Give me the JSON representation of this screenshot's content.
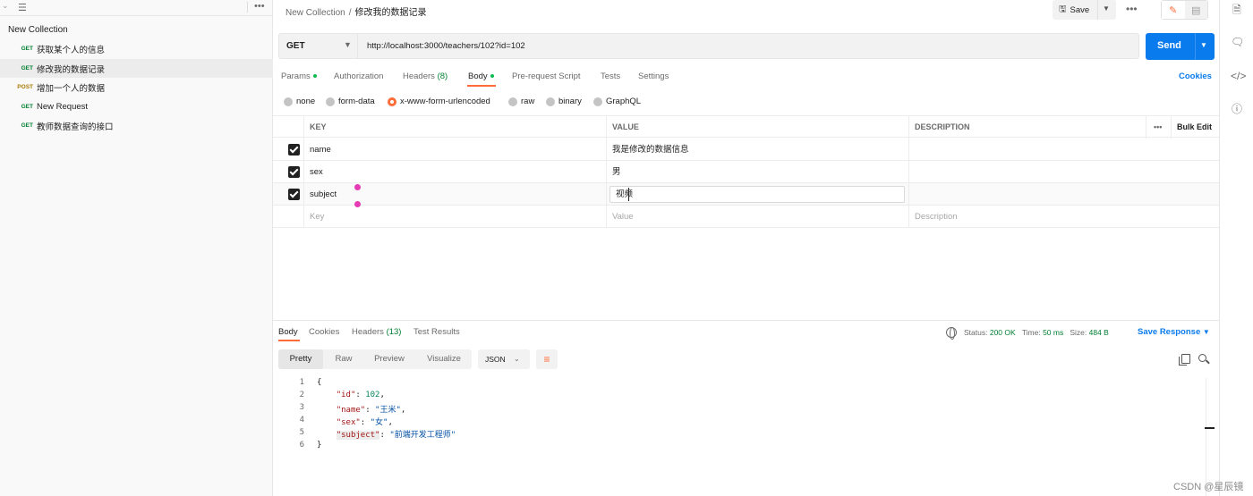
{
  "sidebar": {
    "collection_title": "New Collection",
    "requests": [
      {
        "method": "GET",
        "name": "获取某个人的信息"
      },
      {
        "method": "GET",
        "name": "修改我的数据记录"
      },
      {
        "method": "POST",
        "name": "增加一个人的数据"
      },
      {
        "method": "GET",
        "name": "New Request"
      },
      {
        "method": "GET",
        "name": "教师数据查询的接口"
      }
    ]
  },
  "header": {
    "breadcrumb_collection": "New Collection",
    "breadcrumb_separator": "/",
    "breadcrumb_request": "修改我的数据记录",
    "save_label": "Save"
  },
  "request": {
    "method": "GET",
    "url": "http://localhost:3000/teachers/102?id=102",
    "send_label": "Send",
    "tabs": {
      "params": "Params",
      "authorization": "Authorization",
      "headers": "Headers",
      "headers_count": "(8)",
      "body": "Body",
      "pre_request": "Pre-request Script",
      "tests": "Tests",
      "settings": "Settings"
    },
    "cookies_label": "Cookies",
    "body_types": [
      "none",
      "form-data",
      "x-www-form-urlencoded",
      "raw",
      "binary",
      "GraphQL"
    ],
    "table": {
      "headers": {
        "key": "KEY",
        "value": "VALUE",
        "description": "DESCRIPTION",
        "more": "•••",
        "bulk_edit": "Bulk Edit"
      },
      "rows": [
        {
          "key": "name",
          "value": "我是修改的数据信息"
        },
        {
          "key": "sex",
          "value": "男"
        },
        {
          "key": "subject",
          "value": "视频"
        }
      ],
      "placeholders": {
        "key": "Key",
        "value": "Value",
        "description": "Description"
      }
    }
  },
  "response": {
    "tabs": {
      "body": "Body",
      "cookies": "Cookies",
      "headers": "Headers",
      "headers_count": "(13)",
      "test_results": "Test Results"
    },
    "status_label": "Status:",
    "status_value": "200 OK",
    "time_label": "Time:",
    "time_value": "50 ms",
    "size_label": "Size:",
    "size_value": "484 B",
    "save_response": "Save Response",
    "formats": [
      "Pretty",
      "Raw",
      "Preview",
      "Visualize"
    ],
    "language": "JSON",
    "code_lines": {
      "l1": "{",
      "l2_key": "\"id\"",
      "l2_val": "102",
      "l3_key": "\"name\"",
      "l3_val": "\"王米\"",
      "l4_key": "\"sex\"",
      "l4_val": "\"女\"",
      "l5_key": "\"subject\"",
      "l5_val": "\"前端开发工程师\"",
      "l6": "}"
    }
  },
  "watermark": "CSDN @星辰镜"
}
